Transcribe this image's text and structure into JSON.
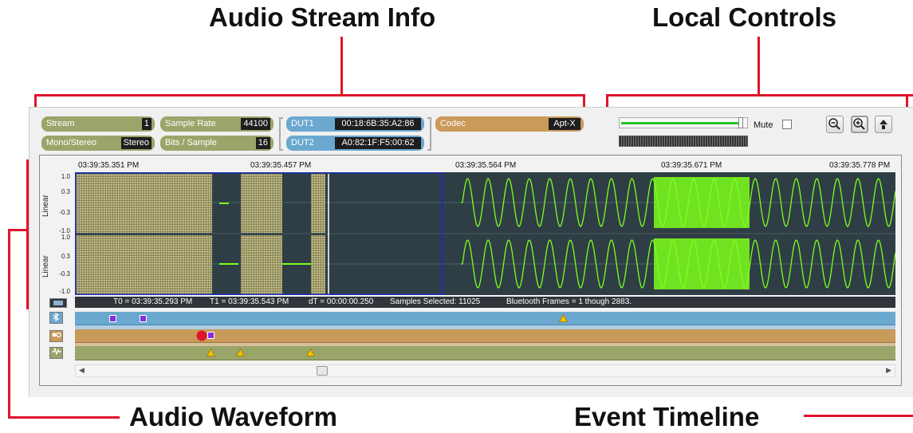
{
  "callouts": {
    "audio_stream_info": "Audio Stream Info",
    "local_controls": "Local Controls",
    "audio_waveform": "Audio Waveform",
    "event_timeline": "Event Timeline"
  },
  "stream_info": {
    "stream_label": "Stream",
    "stream_value": "1",
    "mono_stereo_label": "Mono/Stereo",
    "mono_stereo_value": "Stereo",
    "sample_rate_label": "Sample Rate",
    "sample_rate_value": "44100",
    "bits_label": "Bits / Sample",
    "bits_value": "16",
    "dut1_label": "DUT1",
    "dut1_value": "00:18:6B:35:A2:86",
    "dut2_label": "DUT2",
    "dut2_value": "A0:82:1F:F5:00:62",
    "codec_label": "Codec",
    "codec_value": "Apt-X"
  },
  "local_controls": {
    "mute_label": "Mute",
    "mute_checked": false,
    "volume_level": 0.98,
    "zoom_out_icon": "zoom-out-icon",
    "zoom_in_icon": "zoom-in-icon",
    "up_icon": "up-arrow-icon"
  },
  "waveform": {
    "timestamps": [
      "03:39:35.351 PM",
      "03:39:35.457 PM",
      "03:39:35.564 PM",
      "03:39:35.671 PM",
      "03:39:35.778 PM"
    ],
    "channel_scale_label": "Linear",
    "y_ticks": [
      "1.0",
      "0.3",
      "-0.3",
      "-1.0"
    ],
    "status": {
      "t0": "T0 = 03:39:35.293 PM",
      "t1": "T1 = 03:39:35.543 PM",
      "dt": "dT = 00:00:00.250",
      "samples": "Samples Selected: 11025",
      "frames": "Bluetooth Frames = 1 though 2883."
    }
  },
  "timeline": {
    "tracks": [
      {
        "name": "bluetooth",
        "icon": "bluetooth-icon",
        "color": "#6aa8cf"
      },
      {
        "name": "codec",
        "icon": "codec-icon",
        "color": "#c99a5a"
      },
      {
        "name": "audio",
        "icon": "audio-wave-icon",
        "color": "#9aa56a"
      }
    ]
  },
  "colors": {
    "accent_red": "#e0142c",
    "wave_green": "#7cff1c",
    "wave_bg": "#2f3e45",
    "marker_purple": "#8b2be0",
    "marker_yellow": "#f2c200"
  }
}
